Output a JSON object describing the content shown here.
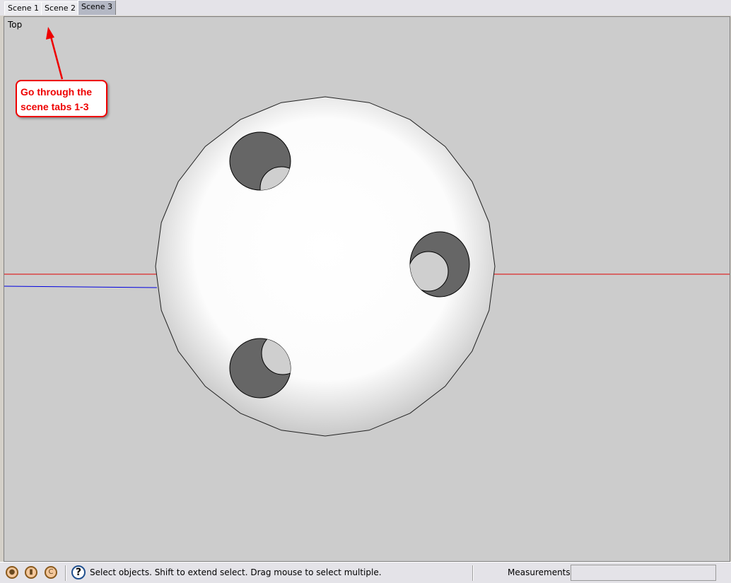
{
  "tabs": [
    {
      "label": "Scene 1"
    },
    {
      "label": "Scene 2"
    },
    {
      "label": "Scene 3",
      "active": true
    }
  ],
  "viewport": {
    "view_label": "Top",
    "axis_colors": {
      "red": "#e00000",
      "blue": "#0000e0"
    }
  },
  "annotation": {
    "text": "Go through the scene tabs 1-3",
    "color": "#e00000"
  },
  "status": {
    "icons": [
      "geo-location-icon",
      "person-icon",
      "credits-icon"
    ],
    "help_icon": "question-icon",
    "message": "Select objects. Shift to extend select. Drag mouse to select multiple.",
    "measurements_label": "Measurements",
    "measurements_value": ""
  }
}
